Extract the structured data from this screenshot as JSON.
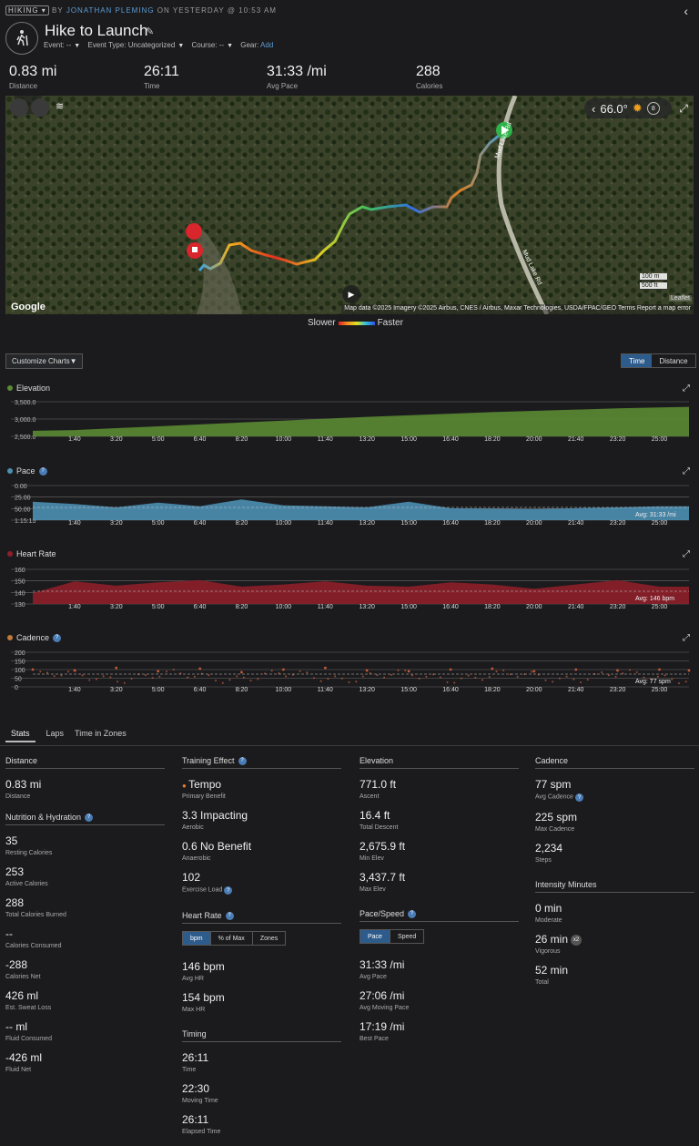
{
  "header": {
    "sport": "HIKING",
    "by": "BY",
    "author": "JONATHAN PLEMING",
    "when": "ON YESTERDAY @ 10:53 AM",
    "title": "Hike to Launch",
    "event": "Event: --",
    "event_type": "Event Type: Uncategorized",
    "course": "Course: --",
    "gear_label": "Gear:",
    "gear_link": "Add"
  },
  "summary": [
    {
      "value": "0.83 mi",
      "label": "Distance"
    },
    {
      "value": "26:11",
      "label": "Time"
    },
    {
      "value": "31:33 /mi",
      "label": "Avg Pace"
    },
    {
      "value": "288",
      "label": "Calories"
    }
  ],
  "map": {
    "temperature": "66.0°",
    "weather_count": "8",
    "road1": "Mud Lake Rd",
    "road2": "Mud Lake Rd",
    "scale_m": "100 m",
    "scale_ft": "500 ft",
    "leaflet": "Leaflet",
    "attribution": "Map data ©2025 Imagery ©2025 Airbus, CNES / Airbus, Maxar Technologies, USDA/FPAC/GEO   Terms   Report a map error",
    "google": "Google",
    "legend_slow": "Slower",
    "legend_fast": "Faster"
  },
  "chart_controls": {
    "customize": "Customize Charts",
    "time": "Time",
    "distance": "Distance"
  },
  "charts": {
    "time_ticks": [
      "1:40",
      "3:20",
      "5:00",
      "6:40",
      "8:20",
      "10:00",
      "11:40",
      "13:20",
      "15:00",
      "16:40",
      "18:20",
      "20:00",
      "21:40",
      "23:20",
      "25:00"
    ],
    "elevation": {
      "title": "Elevation",
      "color": "#5b8a33",
      "yticks": [
        "3,500.0",
        "3,000.0",
        "2,500.0"
      ]
    },
    "pace": {
      "title": "Pace",
      "color": "#4d8fb3",
      "yticks": [
        "0.00",
        "25.00",
        "50.00",
        "1:15:15"
      ],
      "avg": "Avg: 31:33 /mi"
    },
    "heart_rate": {
      "title": "Heart Rate",
      "color": "#8e1f2a",
      "yticks": [
        "160",
        "150",
        "140",
        "130"
      ],
      "avg": "Avg: 146 bpm"
    },
    "cadence": {
      "title": "Cadence",
      "color": "#c05a3a",
      "yticks": [
        "200",
        "150",
        "100",
        "50",
        "0"
      ],
      "avg": "Avg: 77 spm"
    }
  },
  "chart_data": [
    {
      "type": "area",
      "title": "Elevation",
      "x": [
        0,
        1.67,
        3.33,
        5,
        6.67,
        8.33,
        10,
        11.67,
        13.33,
        15,
        16.67,
        18.33,
        20,
        21.67,
        23.33,
        25,
        26.18
      ],
      "values": [
        2676,
        2700,
        2760,
        2820,
        2880,
        2940,
        3000,
        3060,
        3120,
        3170,
        3220,
        3270,
        3310,
        3350,
        3390,
        3420,
        3438
      ],
      "ylim": [
        2500,
        3600
      ]
    },
    {
      "type": "area",
      "title": "Pace",
      "x": [
        0,
        1.67,
        3.33,
        5,
        6.67,
        8.33,
        10,
        11.67,
        13.33,
        15,
        16.67,
        18.33,
        20,
        21.67,
        23.33,
        25,
        26.18
      ],
      "values": [
        40,
        35,
        28,
        38,
        30,
        45,
        32,
        30,
        28,
        40,
        26,
        25,
        24,
        26,
        28,
        30,
        30
      ],
      "ylim": [
        0,
        75
      ]
    },
    {
      "type": "area",
      "title": "Heart Rate",
      "x": [
        0,
        1.67,
        3.33,
        5,
        6.67,
        8.33,
        10,
        11.67,
        13.33,
        15,
        16.67,
        18.33,
        20,
        21.67,
        23.33,
        25,
        26.18
      ],
      "values": [
        140,
        151,
        147,
        150,
        152,
        146,
        148,
        151,
        147,
        146,
        150,
        148,
        144,
        148,
        152,
        146,
        146
      ],
      "ylim": [
        130,
        162
      ]
    },
    {
      "type": "scatter",
      "title": "Cadence",
      "x": [
        0,
        1.67,
        3.33,
        5,
        6.67,
        8.33,
        10,
        11.67,
        13.33,
        15,
        16.67,
        18.33,
        20,
        21.67,
        23.33,
        25,
        26.18
      ],
      "values": [
        100,
        95,
        110,
        90,
        105,
        85,
        100,
        110,
        95,
        90,
        100,
        105,
        90,
        100,
        95,
        100,
        95
      ],
      "ylim": [
        0,
        200
      ]
    }
  ],
  "tabs": [
    "Stats",
    "Laps",
    "Time in Zones"
  ],
  "stats": {
    "distance": {
      "heading": "Distance",
      "items": [
        {
          "v": "0.83 mi",
          "l": "Distance"
        }
      ]
    },
    "nutrition": {
      "heading": "Nutrition & Hydration",
      "items": [
        {
          "v": "35",
          "l": "Resting Calories"
        },
        {
          "v": "253",
          "l": "Active Calories"
        },
        {
          "v": "288",
          "l": "Total Calories Burned"
        },
        {
          "v": "--",
          "l": "Calories Consumed"
        },
        {
          "v": "-288",
          "l": "Calories Net"
        },
        {
          "v": "426 ml",
          "l": "Est. Sweat Loss"
        },
        {
          "v": "-- ml",
          "l": "Fluid Consumed"
        },
        {
          "v": "-426 ml",
          "l": "Fluid Net"
        }
      ]
    },
    "training": {
      "heading": "Training Effect",
      "items": [
        {
          "v": "Tempo",
          "l": "Primary Benefit"
        },
        {
          "v": "3.3 Impacting",
          "l": "Aerobic"
        },
        {
          "v": "0.6 No Benefit",
          "l": "Anaerobic"
        },
        {
          "v": "102",
          "l": "Exercise Load"
        }
      ]
    },
    "heart": {
      "heading": "Heart Rate",
      "seg": [
        "bpm",
        "% of Max",
        "Zones"
      ],
      "items": [
        {
          "v": "146 bpm",
          "l": "Avg HR"
        },
        {
          "v": "154 bpm",
          "l": "Max HR"
        }
      ]
    },
    "timing": {
      "heading": "Timing",
      "items": [
        {
          "v": "26:11",
          "l": "Time"
        },
        {
          "v": "22:30",
          "l": "Moving Time"
        },
        {
          "v": "26:11",
          "l": "Elapsed Time"
        }
      ]
    },
    "elevation": {
      "heading": "Elevation",
      "items": [
        {
          "v": "771.0 ft",
          "l": "Ascent"
        },
        {
          "v": "16.4 ft",
          "l": "Total Descent"
        },
        {
          "v": "2,675.9 ft",
          "l": "Min Elev"
        },
        {
          "v": "3,437.7 ft",
          "l": "Max Elev"
        }
      ]
    },
    "pace": {
      "heading": "Pace/Speed",
      "seg": [
        "Pace",
        "Speed"
      ],
      "items": [
        {
          "v": "31:33 /mi",
          "l": "Avg Pace"
        },
        {
          "v": "27:06 /mi",
          "l": "Avg Moving Pace"
        },
        {
          "v": "17:19 /mi",
          "l": "Best Pace"
        }
      ]
    },
    "cadence": {
      "heading": "Cadence",
      "items": [
        {
          "v": "77 spm",
          "l": "Avg Cadence"
        },
        {
          "v": "225 spm",
          "l": "Max Cadence"
        },
        {
          "v": "2,234",
          "l": "Steps"
        }
      ]
    },
    "intensity": {
      "heading": "Intensity Minutes",
      "items": [
        {
          "v": "0 min",
          "l": "Moderate"
        },
        {
          "v": "26 min",
          "l": "Vigorous",
          "badge": "x2"
        },
        {
          "v": "52 min",
          "l": "Total"
        }
      ]
    }
  }
}
